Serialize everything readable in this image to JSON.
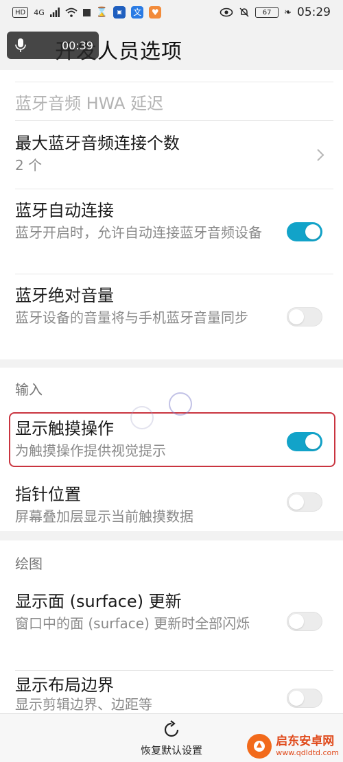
{
  "status_bar": {
    "hd": "HD",
    "signal": "4G",
    "battery": "67",
    "time": "05:29"
  },
  "recording": {
    "time": "00:39"
  },
  "header": {
    "title": "开发人员选项"
  },
  "rows": [
    {
      "title": "蓝牙音频 HWA 延迟",
      "disabled": true
    },
    {
      "title": "最大蓝牙音频连接个数",
      "subtitle": "2 个",
      "control": "chevron"
    },
    {
      "title": "蓝牙自动连接",
      "subtitle": "蓝牙开启时，允许自动连接蓝牙音频设备",
      "control": "toggle",
      "on": true
    },
    {
      "title": "蓝牙绝对音量",
      "subtitle": "蓝牙设备的音量将与手机蓝牙音量同步",
      "control": "toggle",
      "on": false
    }
  ],
  "sections": {
    "input": {
      "label": "输入",
      "rows": [
        {
          "title": "显示触摸操作",
          "subtitle": "为触摸操作提供视觉提示",
          "control": "toggle",
          "on": true
        },
        {
          "title": "指针位置",
          "subtitle": "屏幕叠加层显示当前触摸数据",
          "control": "toggle",
          "on": false
        }
      ]
    },
    "drawing": {
      "label": "绘图",
      "rows": [
        {
          "title": "显示面 (surface) 更新",
          "subtitle": "窗口中的面 (surface) 更新时全部闪烁",
          "control": "toggle",
          "on": false
        },
        {
          "title": "显示布局边界",
          "subtitle": "显示剪辑边界、边距等",
          "control": "toggle",
          "on": false
        }
      ]
    }
  },
  "bottom_bar": {
    "reset_label": "恢复默认设置"
  },
  "watermark": {
    "name": "启东安卓网",
    "url": "www.qdldtd.com"
  },
  "colors": {
    "accent": "#12a3c9",
    "highlight": "#c9343f"
  }
}
